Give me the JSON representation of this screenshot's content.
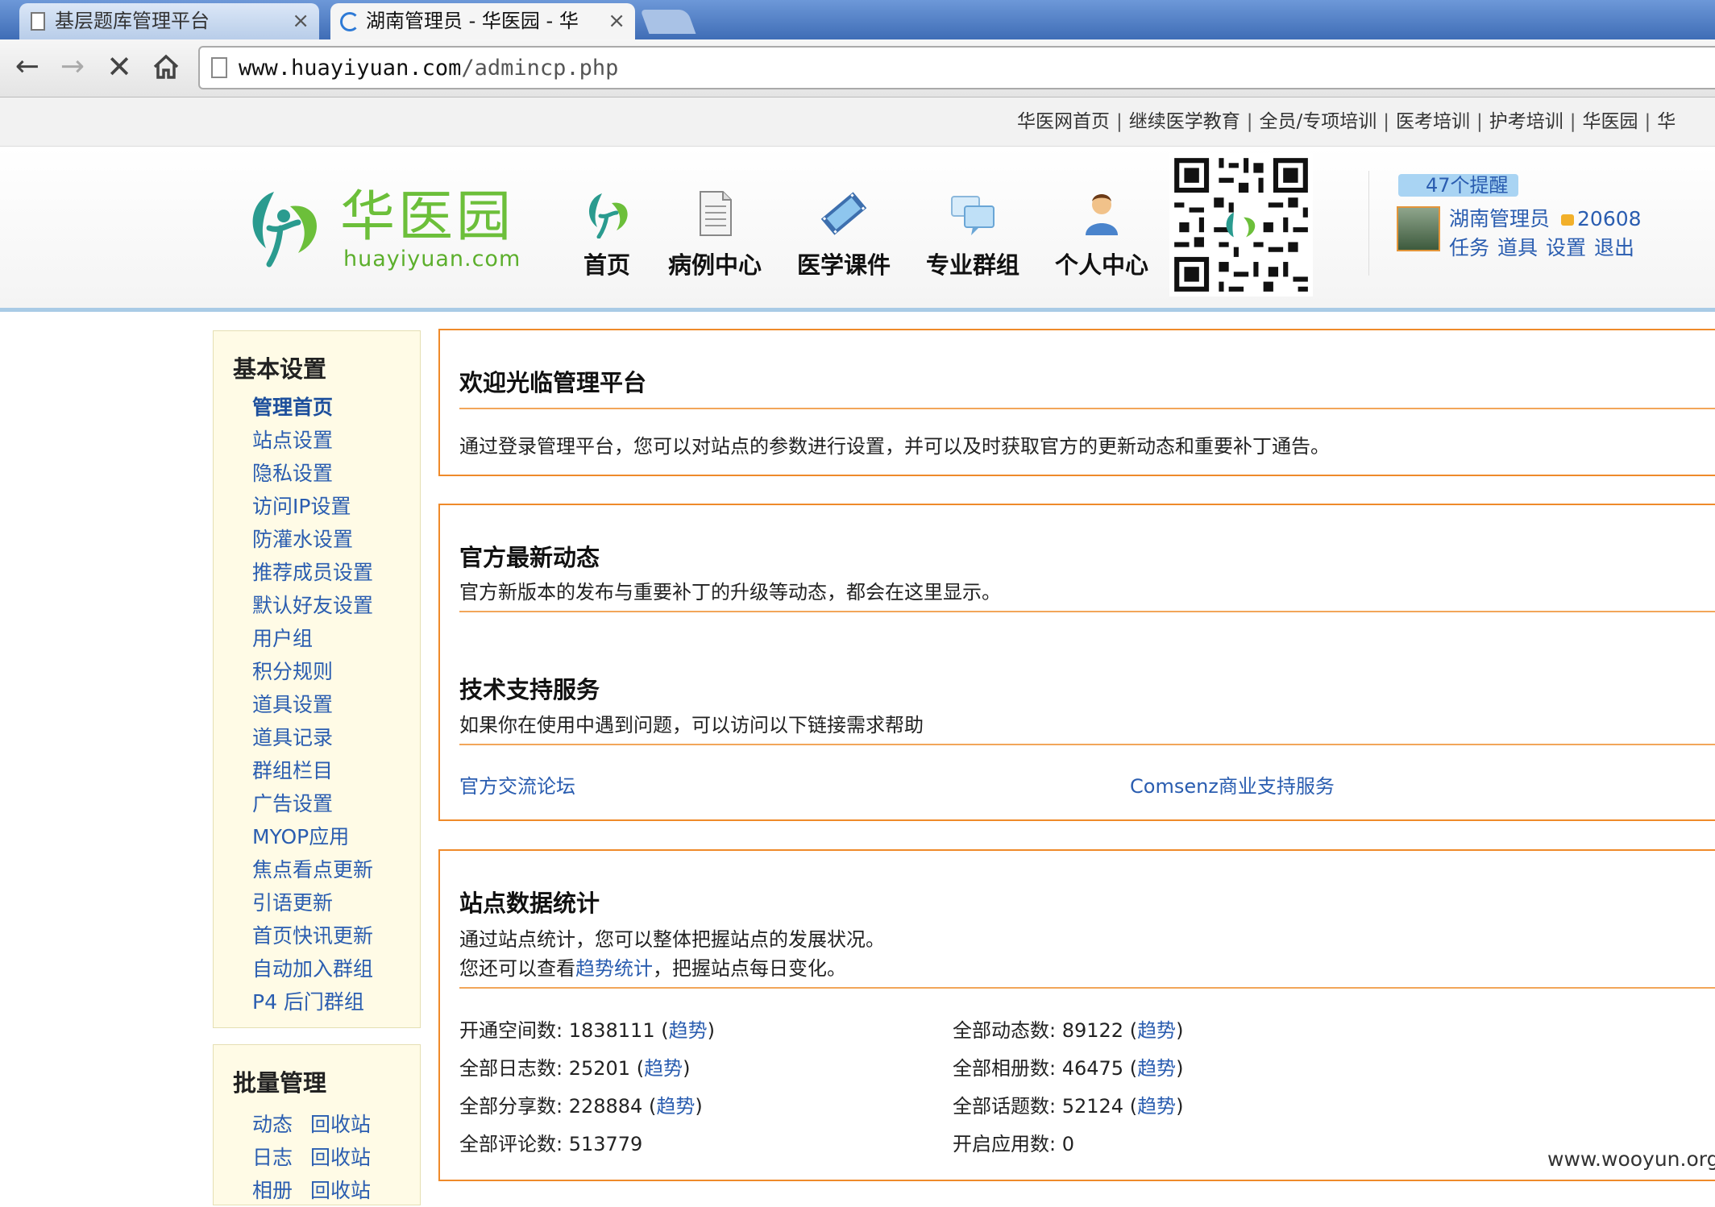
{
  "browser": {
    "tabs": [
      {
        "title": "基层题库管理平台"
      },
      {
        "title": "湖南管理员 - 华医园 - 华"
      }
    ],
    "url": {
      "host": "www.huayiyuan.com",
      "path": "/admincp.php"
    }
  },
  "topnav": {
    "links": [
      "华医网首页",
      "继续医学教育",
      "全员/专项培训",
      "医考培训",
      "护考培训",
      "华医园",
      "华"
    ]
  },
  "header": {
    "logo": {
      "cn": "华医园",
      "en": "huayiyuan.com"
    },
    "nav": [
      {
        "label": "首页",
        "icon": "leaf-logo-icon"
      },
      {
        "label": "病例中心",
        "icon": "document-icon"
      },
      {
        "label": "医学课件",
        "icon": "film-icon"
      },
      {
        "label": "专业群组",
        "icon": "chat-bubbles-icon"
      },
      {
        "label": "个人中心",
        "icon": "person-icon"
      }
    ],
    "notice": "47个提醒",
    "user": {
      "name": "湖南管理员",
      "credits": "20608",
      "links": [
        "任务",
        "道具",
        "设置",
        "退出"
      ]
    }
  },
  "sidebar": {
    "basic": {
      "title": "基本设置",
      "items": [
        "管理首页",
        "站点设置",
        "隐私设置",
        "访问IP设置",
        "防灌水设置",
        "推荐成员设置",
        "默认好友设置",
        "用户组",
        "积分规则",
        "道具设置",
        "道具记录",
        "群组栏目",
        "广告设置",
        "MYOP应用",
        "焦点看点更新",
        "引语更新",
        "首页快讯更新",
        "自动加入群组",
        "P4 后门群组"
      ],
      "active": "管理首页"
    },
    "batch": {
      "title": "批量管理",
      "rows": [
        [
          "动态",
          "回收站"
        ],
        [
          "日志",
          "回收站"
        ],
        [
          "相册",
          "回收站"
        ]
      ]
    }
  },
  "main": {
    "welcome": {
      "title": "欢迎光临管理平台",
      "text": "通过登录管理平台，您可以对站点的参数进行设置，并可以及时获取官方的更新动态和重要补丁通告。"
    },
    "news": {
      "title": "官方最新动态",
      "text": "官方新版本的发布与重要补丁的升级等动态，都会在这里显示。",
      "support_title": "技术支持服务",
      "support_text": "如果你在使用中遇到问题，可以访问以下链接需求帮助",
      "link1": "官方交流论坛",
      "link2": "Comsenz商业支持服务"
    },
    "stats": {
      "title": "站点数据统计",
      "line1": "通过站点统计，您可以整体把握站点的发展状况。",
      "line2_prefix": "您还可以查看",
      "line2_link": "趋势统计",
      "line2_suffix": "，把握站点每日变化。",
      "trend": "趋势",
      "items": [
        {
          "label": "开通空间数: 1838111",
          "trend": true
        },
        {
          "label": "全部动态数: 89122",
          "trend": true
        },
        {
          "label": "全部日志数: 25201",
          "trend": true
        },
        {
          "label": "全部相册数: 46475",
          "trend": true
        },
        {
          "label": "全部分享数: 228884",
          "trend": true
        },
        {
          "label": "全部话题数: 52124",
          "trend": true
        },
        {
          "label": "全部评论数: 513779",
          "trend": false
        },
        {
          "label": "开启应用数: 0",
          "trend": false
        }
      ]
    }
  },
  "watermark": "www.wooyun.org",
  "colors": {
    "accent_orange": "#ef8a2a",
    "link_blue": "#2a5db0",
    "logo_green": "#6cbf3a",
    "header_border": "#a9cbe6"
  }
}
